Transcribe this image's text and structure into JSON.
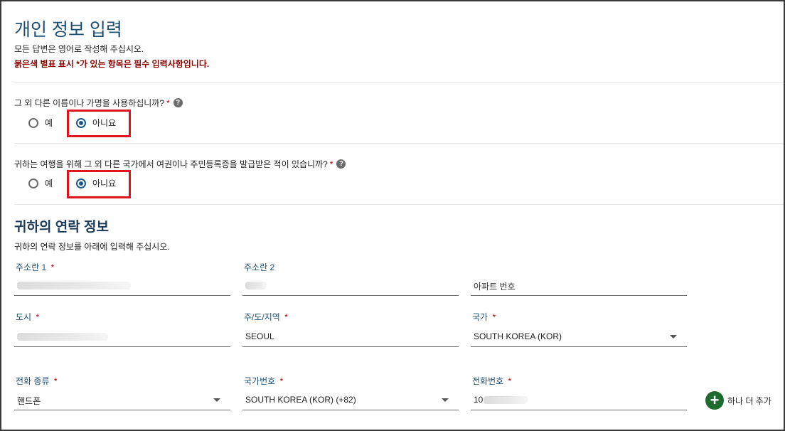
{
  "header": {
    "title": "개인 정보 입력",
    "intro": "모든 답변은 영어로 작성해 주십시오.",
    "required_note": "붉은색 별표 표시 *가 있는 항목은 필수 입력사항입니다."
  },
  "questions": [
    {
      "text": "그 외 다른 이름이나 가명을 사용하십니까?",
      "required_mark": "*",
      "help_icon": "?",
      "options": [
        "예",
        "아니요"
      ],
      "selected": "아니요"
    },
    {
      "text": "귀하는 여행을 위해 그 외 다른 국가에서 여권이나 주민등록증을 발급받은 적이 있습니까?",
      "required_mark": "*",
      "help_icon": "?",
      "options": [
        "예",
        "아니요"
      ],
      "selected": "아니요"
    }
  ],
  "contact": {
    "title": "귀하의 연락 정보",
    "description": "귀하의 연락 정보를 아래에 입력해 주십시오.",
    "fields": {
      "address1": {
        "label": "주소란 1",
        "required": "*"
      },
      "address2": {
        "label": "주소란 2"
      },
      "apartment": {
        "placeholder": "아파트 번호"
      },
      "city": {
        "label": "도시",
        "required": "*"
      },
      "state": {
        "label": "주/도/지역",
        "required": "*",
        "value": "SEOUL"
      },
      "country": {
        "label": "국가",
        "required": "*",
        "value": "SOUTH KOREA (KOR)"
      },
      "phone_type": {
        "label": "전화 종류",
        "required": "*",
        "value": "핸드폰"
      },
      "country_code": {
        "label": "국가번호",
        "required": "*",
        "value": "SOUTH KOREA (KOR) (+82)"
      },
      "phone_number": {
        "label": "전화번호",
        "required": "*",
        "value_visible_prefix": "10"
      }
    },
    "add_more": {
      "icon": "plus-icon",
      "label": "하나 더 추가"
    }
  },
  "colors": {
    "title": "#1d4f73",
    "required": "#c00000",
    "radio_selected": "#1c5a8e",
    "highlight": "#e0141e",
    "add_button": "#1e6b2f"
  }
}
